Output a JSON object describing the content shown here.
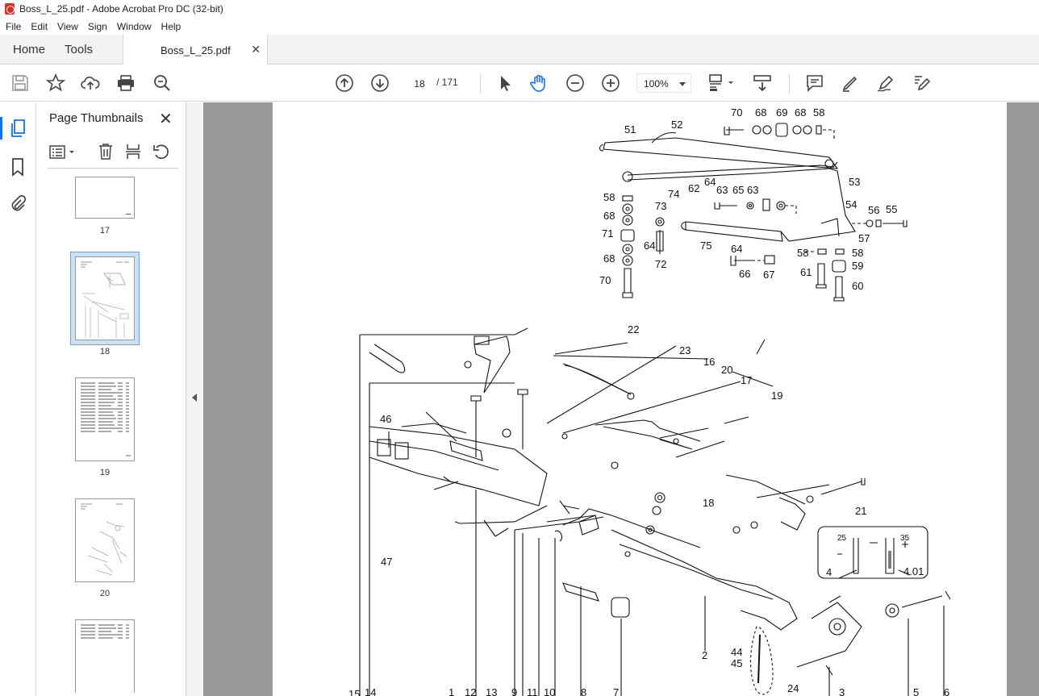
{
  "window": {
    "title": "Boss_L_25.pdf - Adobe Acrobat Pro DC (32-bit)"
  },
  "menu": {
    "items": [
      "File",
      "Edit",
      "View",
      "Sign",
      "Window",
      "Help"
    ]
  },
  "tabs": {
    "home": "Home",
    "tools": "Tools",
    "document": "Boss_L_25.pdf"
  },
  "toolbar": {
    "current_page": "18",
    "total_pages": "/ 171",
    "zoom": "100%"
  },
  "thumbnails": {
    "title": "Page Thumbnails",
    "pages": [
      {
        "label": "17",
        "selected": false
      },
      {
        "label": "18",
        "selected": true
      },
      {
        "label": "19",
        "selected": false
      },
      {
        "label": "20",
        "selected": false
      },
      {
        "label": "",
        "selected": false
      }
    ]
  },
  "diagram": {
    "upper_labels": [
      "70",
      "68",
      "69",
      "68",
      "58",
      "51",
      "52",
      "53",
      "58",
      "74",
      "62",
      "64",
      "63",
      "65",
      "63",
      "54",
      "56",
      "55",
      "68",
      "73",
      "71",
      "75",
      "57",
      "64",
      "64",
      "58",
      "58",
      "68",
      "72",
      "66",
      "67",
      "59",
      "61",
      "70",
      "60"
    ],
    "lower_labels": [
      "22",
      "23",
      "16",
      "20",
      "17",
      "19",
      "46",
      "18",
      "21",
      "47",
      "25",
      "35",
      "4",
      "4.01",
      "2",
      "44",
      "45",
      "24",
      "15",
      "14",
      "1",
      "12",
      "13",
      "9",
      "11",
      "10",
      "8",
      "7",
      "3",
      "5",
      "6"
    ]
  },
  "icons": [
    "save-icon",
    "star-icon",
    "upload-icon",
    "print-icon",
    "search-icon",
    "prev-page-icon",
    "next-page-icon",
    "select-arrow-icon",
    "hand-icon",
    "zoom-out-icon",
    "zoom-in-icon",
    "fit-page-icon",
    "scroll-mode-icon",
    "comment-icon",
    "highlight-icon",
    "sign-icon",
    "edit-icon"
  ]
}
